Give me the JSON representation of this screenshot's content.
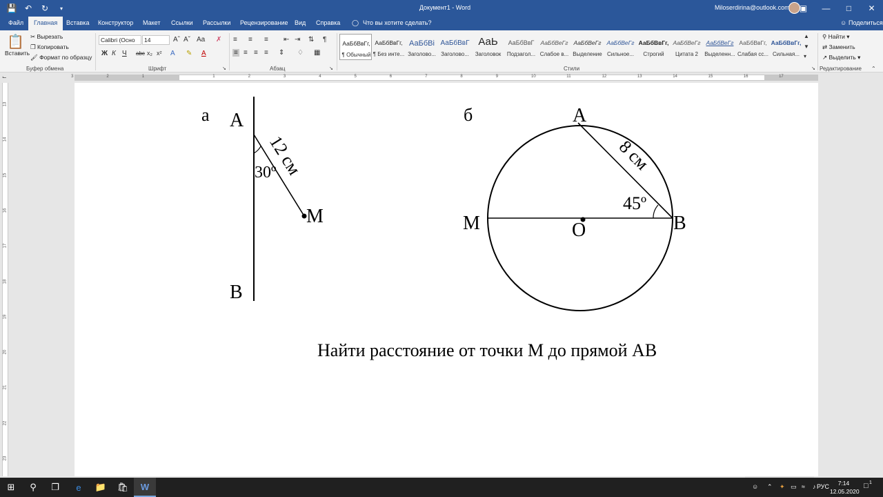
{
  "titlebar": {
    "title": "Документ1 - Word",
    "user": "Miloserdirina@outlook.com"
  },
  "tabs": [
    "Файл",
    "Главная",
    "Вставка",
    "Конструктор",
    "Макет",
    "Ссылки",
    "Рассылки",
    "Рецензирование",
    "Вид",
    "Справка"
  ],
  "tell_me": "Что вы хотите сделать?",
  "share": "Поделиться",
  "clipboard": {
    "paste": "Вставить",
    "cut": "Вырезать",
    "copy": "Копировать",
    "format_painter": "Формат по образцу",
    "label": "Буфер обмена"
  },
  "font": {
    "name": "Calibri (Осно",
    "size": "14",
    "bold": "Ж",
    "italic": "К",
    "underline": "Ч",
    "strike": "abc",
    "subscript": "x₂",
    "superscript": "x²",
    "label": "Шрифт"
  },
  "paragraph": {
    "label": "Абзац"
  },
  "styles": {
    "label": "Стили",
    "items": [
      {
        "sample": "АаБбВвГг,",
        "name": "¶ Обычный"
      },
      {
        "sample": "АаБбВвГг,",
        "name": "¶ Без инте..."
      },
      {
        "sample": "АаБбВі",
        "name": "Заголово..."
      },
      {
        "sample": "АаБбВвГ",
        "name": "Заголово..."
      },
      {
        "sample": "АаЬ",
        "name": "Заголовок"
      },
      {
        "sample": "АаБбВвГ",
        "name": "Подзагол..."
      },
      {
        "sample": "АаБбВеГг",
        "name": "Слабое в..."
      },
      {
        "sample": "АаБбВеГг",
        "name": "Выделение"
      },
      {
        "sample": "АаБбВеГг",
        "name": "Сильное..."
      },
      {
        "sample": "АаБбВвГг,",
        "name": "Строгий"
      },
      {
        "sample": "АаБбВеГг",
        "name": "Цитата 2"
      },
      {
        "sample": "АаБбВеГг",
        "name": "Выделенн..."
      },
      {
        "sample": "АаБбВвГг,",
        "name": "Слабая сс..."
      },
      {
        "sample": "АаБбВвГг,",
        "name": "Сильная..."
      }
    ]
  },
  "editing": {
    "find": "Найти",
    "replace": "Заменить",
    "select": "Выделить",
    "label": "Редактирование"
  },
  "ruler": {
    "h_numbers": [
      "3",
      "2",
      "1",
      "1",
      "2",
      "3",
      "4",
      "5",
      "6",
      "7",
      "8",
      "9",
      "10",
      "11",
      "12",
      "13",
      "14",
      "15",
      "16",
      "17"
    ],
    "v_numbers": [
      "13",
      "14",
      "15",
      "16",
      "17",
      "18",
      "19",
      "20",
      "21",
      "22",
      "23"
    ]
  },
  "document": {
    "fig_a": {
      "letter": "а",
      "point_A": "A",
      "point_B": "B",
      "point_M": "M",
      "length": "12 см",
      "angle": "30º"
    },
    "fig_b": {
      "letter": "б",
      "point_A": "A",
      "point_B": "B",
      "point_M": "M",
      "point_O": "O",
      "length": "8 см",
      "angle": "45º"
    },
    "task": "Найти расстояние от точки М до прямой АВ"
  },
  "taskbar": {
    "lang": "РУС",
    "time": "7:14",
    "date": "12.05.2020",
    "notifications": "1"
  }
}
